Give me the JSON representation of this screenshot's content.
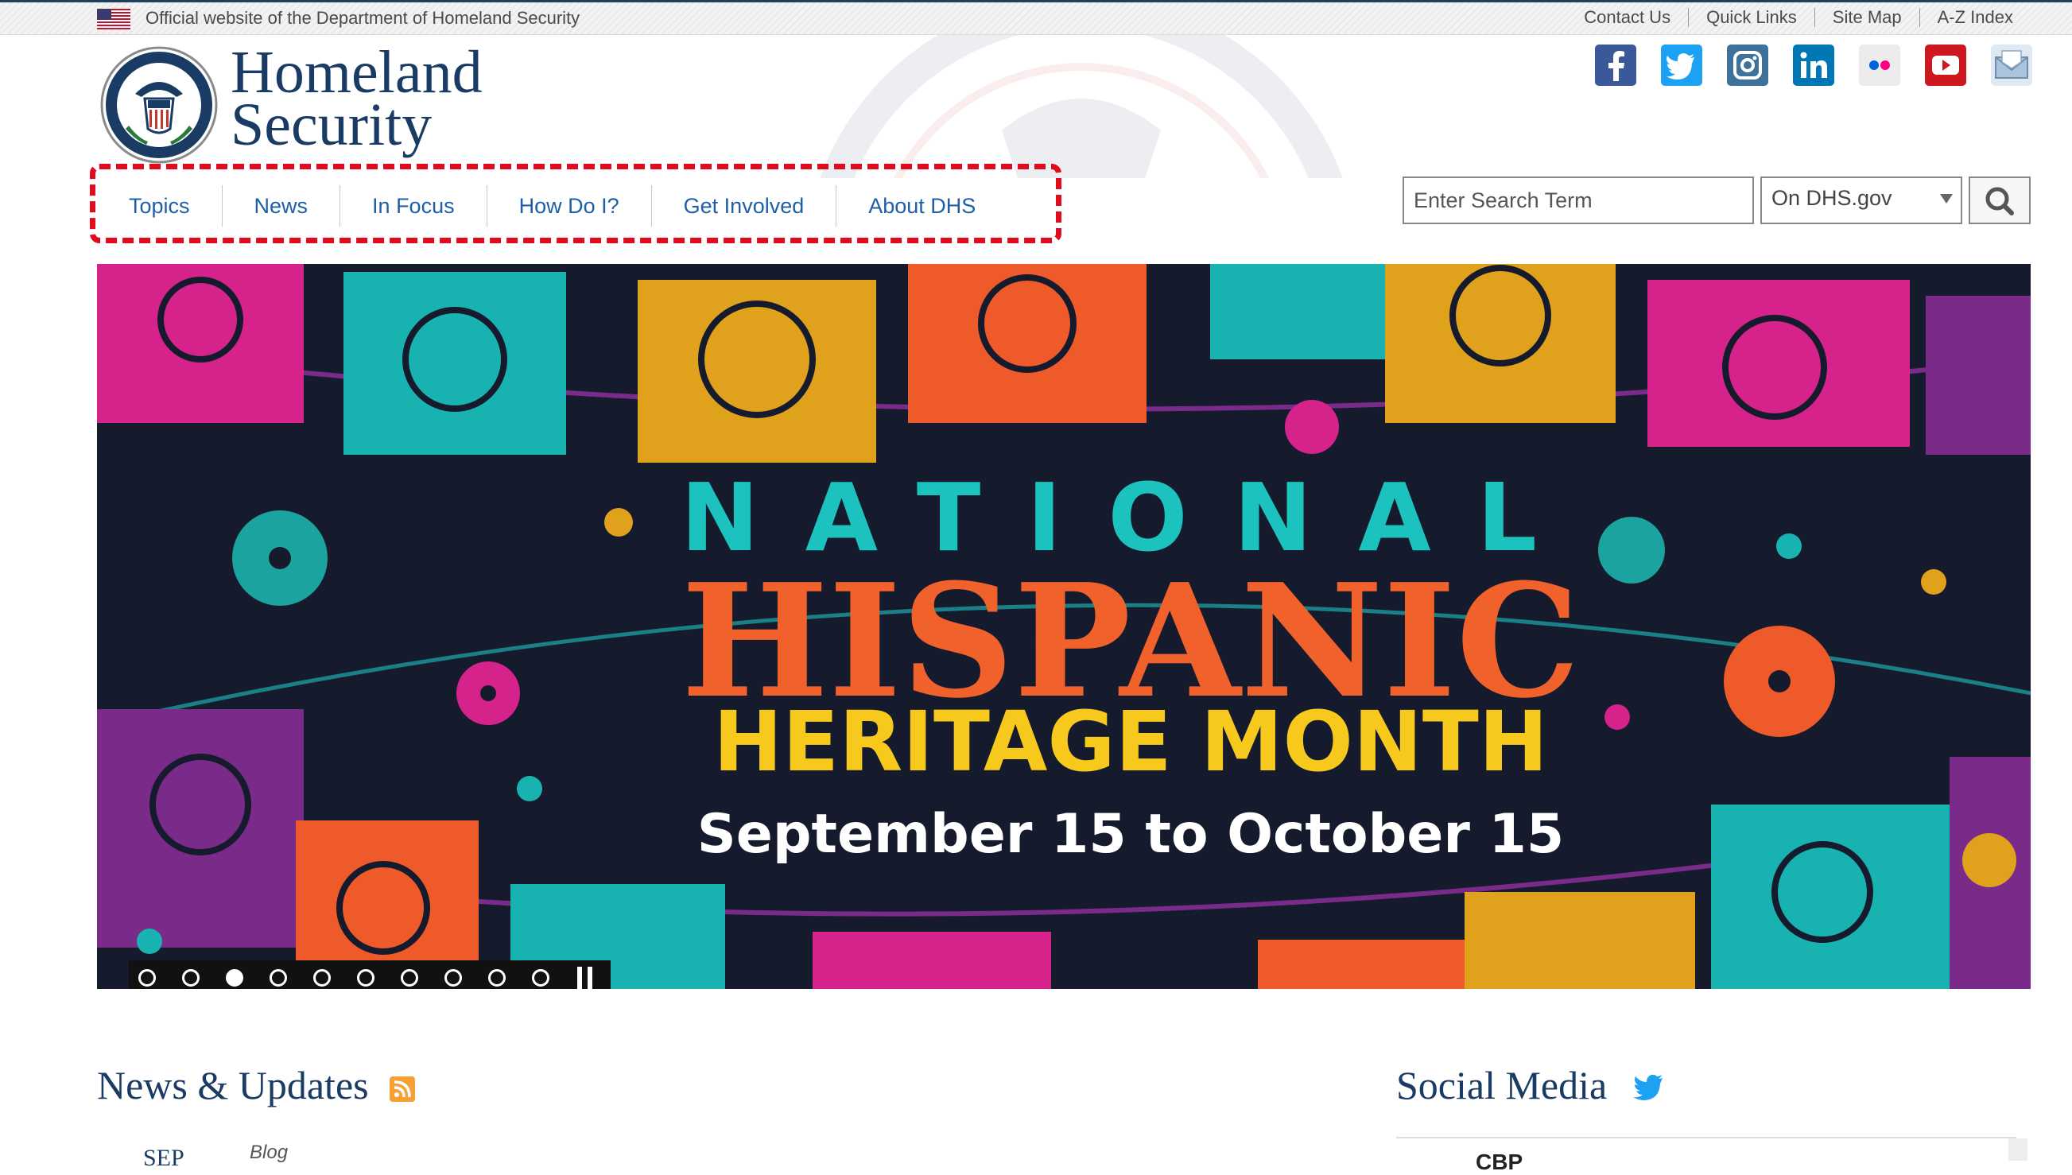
{
  "topbar": {
    "official_text": "Official website of the Department of Homeland Security",
    "links": [
      "Contact Us",
      "Quick Links",
      "Site Map",
      "A-Z Index"
    ]
  },
  "header": {
    "logo_line1": "Homeland",
    "logo_line2": "Security",
    "social_icons": [
      "facebook-icon",
      "twitter-icon",
      "instagram-icon",
      "linkedin-icon",
      "flickr-icon",
      "youtube-icon",
      "email-icon"
    ]
  },
  "nav": {
    "items": [
      "Topics",
      "News",
      "In Focus",
      "How Do I?",
      "Get Involved",
      "About DHS"
    ]
  },
  "search": {
    "placeholder": "Enter Search Term",
    "scope_selected": "On DHS.gov"
  },
  "hero": {
    "line1": "NATIONAL",
    "line2": "HISPANIC",
    "line3": "HERITAGE MONTH",
    "line4": "September 15 to October 15",
    "slide_count": 10,
    "active_slide": 3
  },
  "sections": {
    "news_title": "News & Updates",
    "social_title": "Social Media",
    "news_month": "SEP",
    "news_tag": "Blog",
    "social_account": "CBP"
  },
  "colors": {
    "brand_navy": "#1a3b63",
    "nav_link": "#1f5fa8",
    "highlight_red": "#e00b1c"
  }
}
